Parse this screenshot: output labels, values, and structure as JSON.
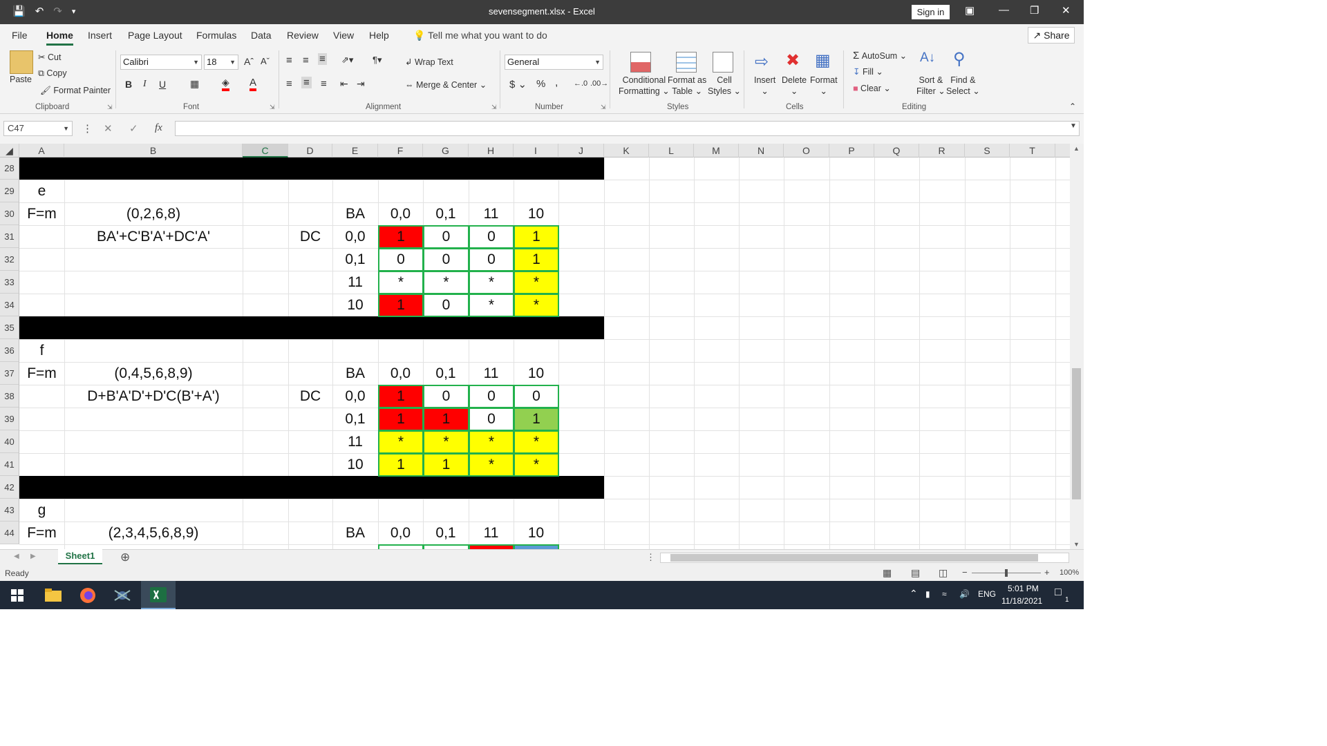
{
  "window": {
    "title": "sevensegment.xlsx  -  Excel",
    "sign_in": "Sign in",
    "share": "Share"
  },
  "menu": {
    "tabs": [
      "File",
      "Home",
      "Insert",
      "Page Layout",
      "Formulas",
      "Data",
      "Review",
      "View",
      "Help"
    ],
    "active": "Home",
    "tell_me": "Tell me what you want to do"
  },
  "ribbon": {
    "clipboard": {
      "paste": "Paste",
      "cut": "Cut",
      "copy": "Copy",
      "format_painter": "Format Painter",
      "label": "Clipboard"
    },
    "font": {
      "name": "Calibri",
      "size": "18",
      "label": "Font",
      "bold": "B",
      "italic": "I",
      "underline": "U"
    },
    "alignment": {
      "wrap_text": "Wrap Text",
      "merge_center": "Merge & Center",
      "label": "Alignment"
    },
    "number": {
      "format": "General",
      "label": "Number",
      "currency": "$",
      "percent": "%",
      "comma": ","
    },
    "styles": {
      "conditional": "Conditional",
      "formatting": "Formatting",
      "format_as": "Format as",
      "table": "Table",
      "cell": "Cell",
      "cell_styles": "Styles",
      "label": "Styles"
    },
    "cells": {
      "insert": "Insert",
      "delete": "Delete",
      "format": "Format",
      "label": "Cells"
    },
    "editing": {
      "autosum": "AutoSum",
      "fill": "Fill",
      "clear": "Clear",
      "sort": "Sort &",
      "filter": "Filter",
      "find": "Find &",
      "select": "Select",
      "label": "Editing"
    }
  },
  "formula_bar": {
    "name_box": "C47",
    "fx": "fx",
    "value": ""
  },
  "columns": [
    "A",
    "B",
    "C",
    "D",
    "E",
    "F",
    "G",
    "H",
    "I",
    "J",
    "K",
    "L",
    "M",
    "N",
    "O",
    "P",
    "Q",
    "R",
    "S",
    "T"
  ],
  "selected_column": "C",
  "rows": [
    "28",
    "29",
    "30",
    "31",
    "32",
    "33",
    "34",
    "35",
    "36",
    "37",
    "38",
    "39",
    "40",
    "41",
    "42",
    "43",
    "44"
  ],
  "blocks": [
    {
      "letter": "e",
      "fm": "F=m",
      "minterms": "(0,2,6,8)",
      "expr": "BA'+C'B'A'+DC'A'",
      "ba": "BA",
      "dc": "DC",
      "col_heads": [
        "0,0",
        "0,1",
        "11",
        "10"
      ],
      "row_heads": [
        "0,0",
        "0,1",
        "11",
        "10"
      ],
      "cells": [
        [
          "1",
          "0",
          "0",
          "1"
        ],
        [
          "0",
          "0",
          "0",
          "1"
        ],
        [
          "*",
          "*",
          "*",
          "*"
        ],
        [
          "1",
          "0",
          "*",
          "*"
        ]
      ],
      "fills": [
        [
          "#ff0000",
          "#ffffff",
          "#ffffff",
          "#ffff00"
        ],
        [
          "#ffffff",
          "#ffffff",
          "#ffffff",
          "#ffff00"
        ],
        [
          "#ffffff",
          "#ffffff",
          "#ffffff",
          "#ffff00"
        ],
        [
          "#ff0000",
          "#ffffff",
          "#ffffff",
          "#ffff00"
        ]
      ]
    },
    {
      "letter": "f",
      "fm": "F=m",
      "minterms": "(0,4,5,6,8,9)",
      "expr": "D+B'A'D'+D'C(B'+A')",
      "ba": "BA",
      "dc": "DC",
      "col_heads": [
        "0,0",
        "0,1",
        "11",
        "10"
      ],
      "row_heads": [
        "0,0",
        "0,1",
        "11",
        "10"
      ],
      "cells": [
        [
          "1",
          "0",
          "0",
          "0"
        ],
        [
          "1",
          "1",
          "0",
          "1"
        ],
        [
          "*",
          "*",
          "*",
          "*"
        ],
        [
          "1",
          "1",
          "*",
          "*"
        ]
      ],
      "fills": [
        [
          "#ff0000",
          "#ffffff",
          "#ffffff",
          "#ffffff"
        ],
        [
          "#ff0000",
          "#ff0000",
          "#ffffff",
          "#92d050"
        ],
        [
          "#ffff00",
          "#ffff00",
          "#ffff00",
          "#ffff00"
        ],
        [
          "#ffff00",
          "#ffff00",
          "#ffff00",
          "#ffff00"
        ]
      ]
    },
    {
      "letter": "g",
      "fm": "F=m",
      "minterms": "(2,3,4,5,6,8,9)",
      "ba": "BA",
      "col_heads": [
        "0,0",
        "0,1",
        "11",
        "10"
      ],
      "partial_fills": [
        "#ffffff",
        "#ffffff",
        "#ff0000",
        "#5b9bd5"
      ]
    }
  ],
  "sheet": {
    "tab": "Sheet1"
  },
  "status": {
    "text": "Ready",
    "zoom": "100%"
  },
  "taskbar": {
    "lang": "ENG",
    "time": "5:01 PM",
    "date": "11/18/2021",
    "notif": "1"
  },
  "colors": {
    "accent": "#217346",
    "kmap_border": "#22b14c",
    "separator": "#000000"
  }
}
